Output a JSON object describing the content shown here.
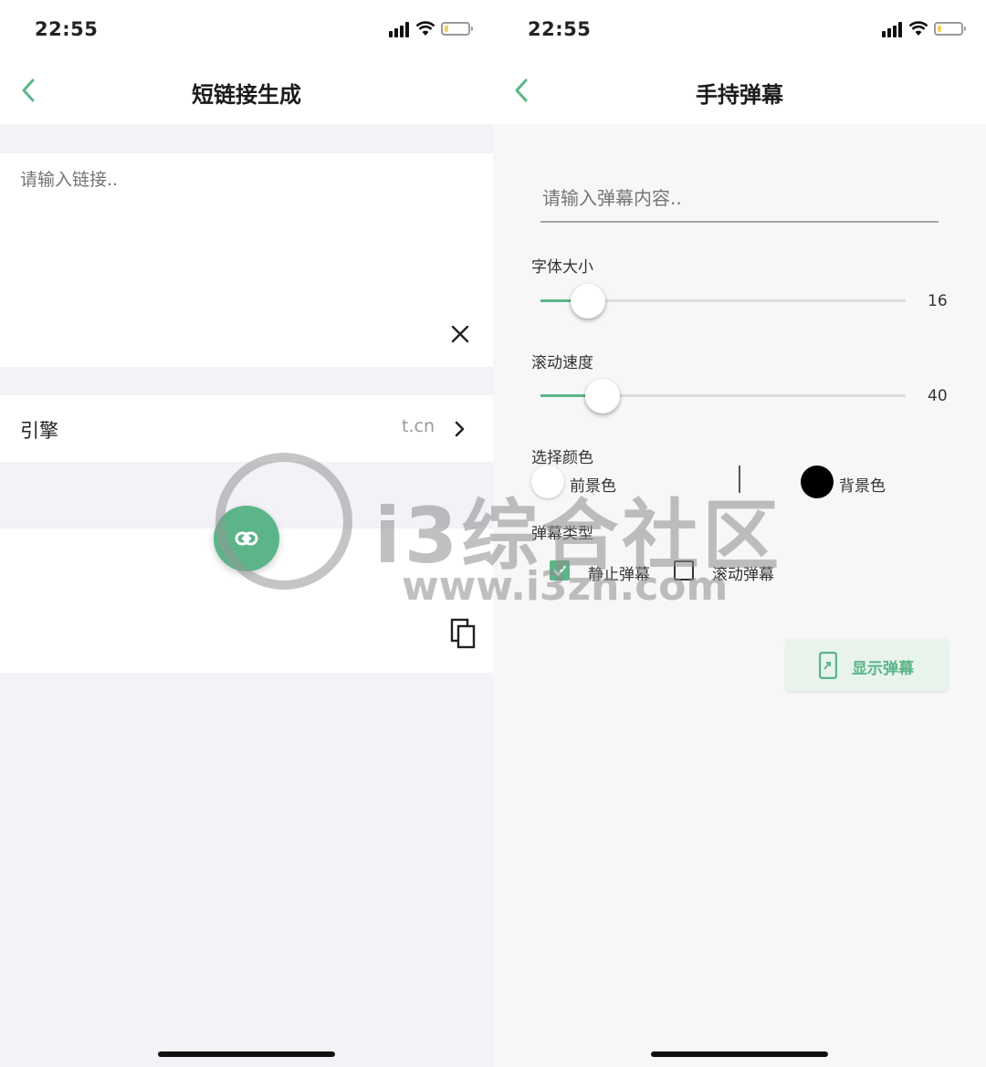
{
  "left": {
    "status": {
      "time": "22:55"
    },
    "nav": {
      "title": "短链接生成"
    },
    "input": {
      "placeholder": "请输入链接.."
    },
    "engine": {
      "label": "引擎",
      "value": "t.cn"
    }
  },
  "right": {
    "status": {
      "time": "22:55"
    },
    "nav": {
      "title": "手持弹幕"
    },
    "input": {
      "placeholder": "请输入弹幕内容.."
    },
    "font_size": {
      "label": "字体大小",
      "value": "16",
      "fraction": 0.13
    },
    "speed": {
      "label": "滚动速度",
      "value": "40",
      "fraction": 0.17
    },
    "color": {
      "label": "选择颜色",
      "foreground_label": "前景色",
      "background_label": "背景色",
      "foreground_color": "#ffffff",
      "background_color": "#000000"
    },
    "type": {
      "label": "弹幕类型",
      "static_label": "静止弹幕",
      "scroll_label": "滚动弹幕",
      "static_checked": true,
      "scroll_checked": false
    },
    "button": {
      "label": "显示弹幕"
    }
  },
  "watermark": {
    "text": "i3综合社区",
    "url": "www.i3zh.com"
  },
  "colors": {
    "accent": "#5bb589",
    "page_bg": "#f2f2f7"
  }
}
